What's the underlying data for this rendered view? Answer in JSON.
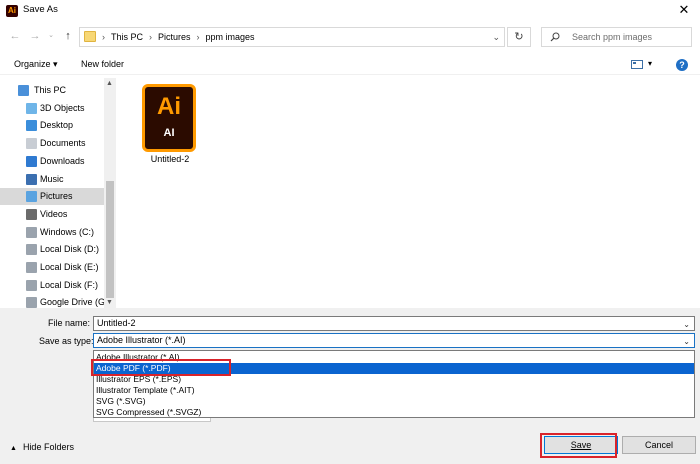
{
  "window": {
    "title": "Save As",
    "app_icon_text": "Ai"
  },
  "address_bar": {
    "crumbs": [
      "This PC",
      "Pictures",
      "ppm images"
    ]
  },
  "search": {
    "placeholder": "Search ppm images"
  },
  "toolbar": {
    "organize_label": "Organize ▾",
    "new_folder_label": "New folder"
  },
  "nav": {
    "items": [
      {
        "label": "This PC",
        "icon": "pc-icon",
        "selected": false
      },
      {
        "label": "3D Objects",
        "icon": "3d-objects-icon",
        "selected": false
      },
      {
        "label": "Desktop",
        "icon": "desktop-icon",
        "selected": false
      },
      {
        "label": "Documents",
        "icon": "documents-icon",
        "selected": false
      },
      {
        "label": "Downloads",
        "icon": "downloads-icon",
        "selected": false
      },
      {
        "label": "Music",
        "icon": "music-icon",
        "selected": false
      },
      {
        "label": "Pictures",
        "icon": "pictures-icon",
        "selected": true
      },
      {
        "label": "Videos",
        "icon": "videos-icon",
        "selected": false
      },
      {
        "label": "Windows (C:)",
        "icon": "drive-icon",
        "selected": false
      },
      {
        "label": "Local Disk (D:)",
        "icon": "drive-icon",
        "selected": false
      },
      {
        "label": "Local Disk (E:)",
        "icon": "drive-icon",
        "selected": false
      },
      {
        "label": "Local Disk (F:)",
        "icon": "drive-icon",
        "selected": false
      },
      {
        "label": "Google Drive (G:",
        "icon": "drive-icon",
        "selected": false
      }
    ]
  },
  "content": {
    "files": [
      {
        "name": "Untitled-2",
        "icon_big": "Ai",
        "icon_small": "AI"
      }
    ]
  },
  "form": {
    "file_name_label": "File name:",
    "file_name_value": "Untitled-2",
    "save_type_label": "Save as type:",
    "save_type_value": "Adobe Illustrator (*.AI)",
    "save_type_options": [
      "Adobe Illustrator (*.AI)",
      "Adobe PDF (*.PDF)",
      "Illustrator EPS (*.EPS)",
      "Illustrator Template (*.AIT)",
      "SVG (*.SVG)",
      "SVG Compressed (*.SVGZ)"
    ],
    "highlighted_option_index": 1
  },
  "footer": {
    "hide_folders_label": "Hide Folders",
    "save_label": "Save",
    "cancel_label": "Cancel"
  },
  "colors": {
    "highlight": "#0a64d0",
    "annotation_red": "#d9232a",
    "ai_orange": "#ff9a00"
  }
}
